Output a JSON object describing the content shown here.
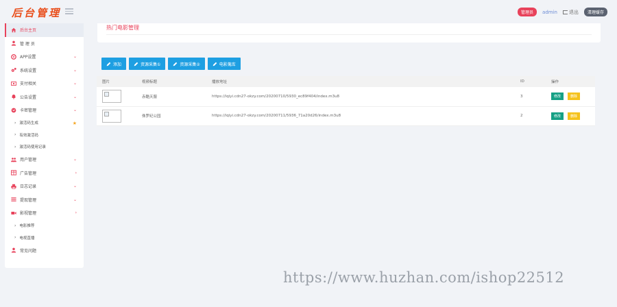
{
  "header": {
    "logo": "后台管理",
    "admin_badge": "管理员",
    "username": "admin",
    "logout": "退出",
    "cache_badge": "清理缓存"
  },
  "sidebar": {
    "items": [
      {
        "label": "后台主页",
        "icon": "home-icon",
        "active": true
      },
      {
        "label": "管 理 员",
        "icon": "user-icon"
      },
      {
        "label": "APP设置",
        "icon": "settings-circle-icon",
        "arrow": "⌄"
      },
      {
        "label": "系统设置",
        "icon": "gears-icon",
        "arrow": "⌄"
      },
      {
        "label": "支付相关",
        "icon": "payment-icon",
        "arrow": "⌄"
      },
      {
        "label": "公告设置",
        "icon": "bell-icon",
        "arrow": "⌄"
      },
      {
        "label": "卡密管理",
        "icon": "globe-icon",
        "arrow": "⌄"
      }
    ],
    "card_sub": [
      {
        "label": "激活码生成",
        "star": "★"
      },
      {
        "label": "有效激活码"
      },
      {
        "label": "激活码使用记录"
      }
    ],
    "items2": [
      {
        "label": "用户管理",
        "icon": "users-icon",
        "arrow": "⌄"
      },
      {
        "label": "广告管理",
        "icon": "grid-icon",
        "arrow": "›"
      },
      {
        "label": "日志记录",
        "icon": "printer-icon",
        "arrow": "⌄"
      },
      {
        "label": "提现管理",
        "icon": "list-icon",
        "arrow": "⌄"
      },
      {
        "label": "影视管理",
        "icon": "video-icon",
        "arrow": "›"
      }
    ],
    "video_sub": [
      {
        "label": "电影推荐"
      },
      {
        "label": "电视直播"
      }
    ],
    "items3": [
      {
        "label": "常见问题",
        "icon": "user-icon"
      }
    ]
  },
  "main": {
    "title": "热门电影管理",
    "buttons": [
      "添加",
      "资源采集①",
      "资源采集②",
      "电影蒐库"
    ],
    "table": {
      "headers": [
        "图片",
        "视频标题",
        "播放地址",
        "ID",
        "操作"
      ],
      "rows": [
        {
          "title": "赤酷天服",
          "url": "https://iqiyi.cdn27-okzy.com/20200710/5930_ec89f404/index.m3u8",
          "id": "3",
          "edit": "修改",
          "delete": "删除"
        },
        {
          "title": "侏罗纪公园",
          "url": "https://iqiyi.cdn27-okzy.com/20200711/5936_71a20d26/index.m3u8",
          "id": "2",
          "edit": "修改",
          "delete": "删除"
        }
      ]
    }
  },
  "watermark": "https://www.huzhan.com/ishop22512",
  "colors": {
    "accent": "#e8425b",
    "primary_button": "#1e9fe2",
    "edit": "#16a085",
    "delete": "#f5c21b"
  }
}
